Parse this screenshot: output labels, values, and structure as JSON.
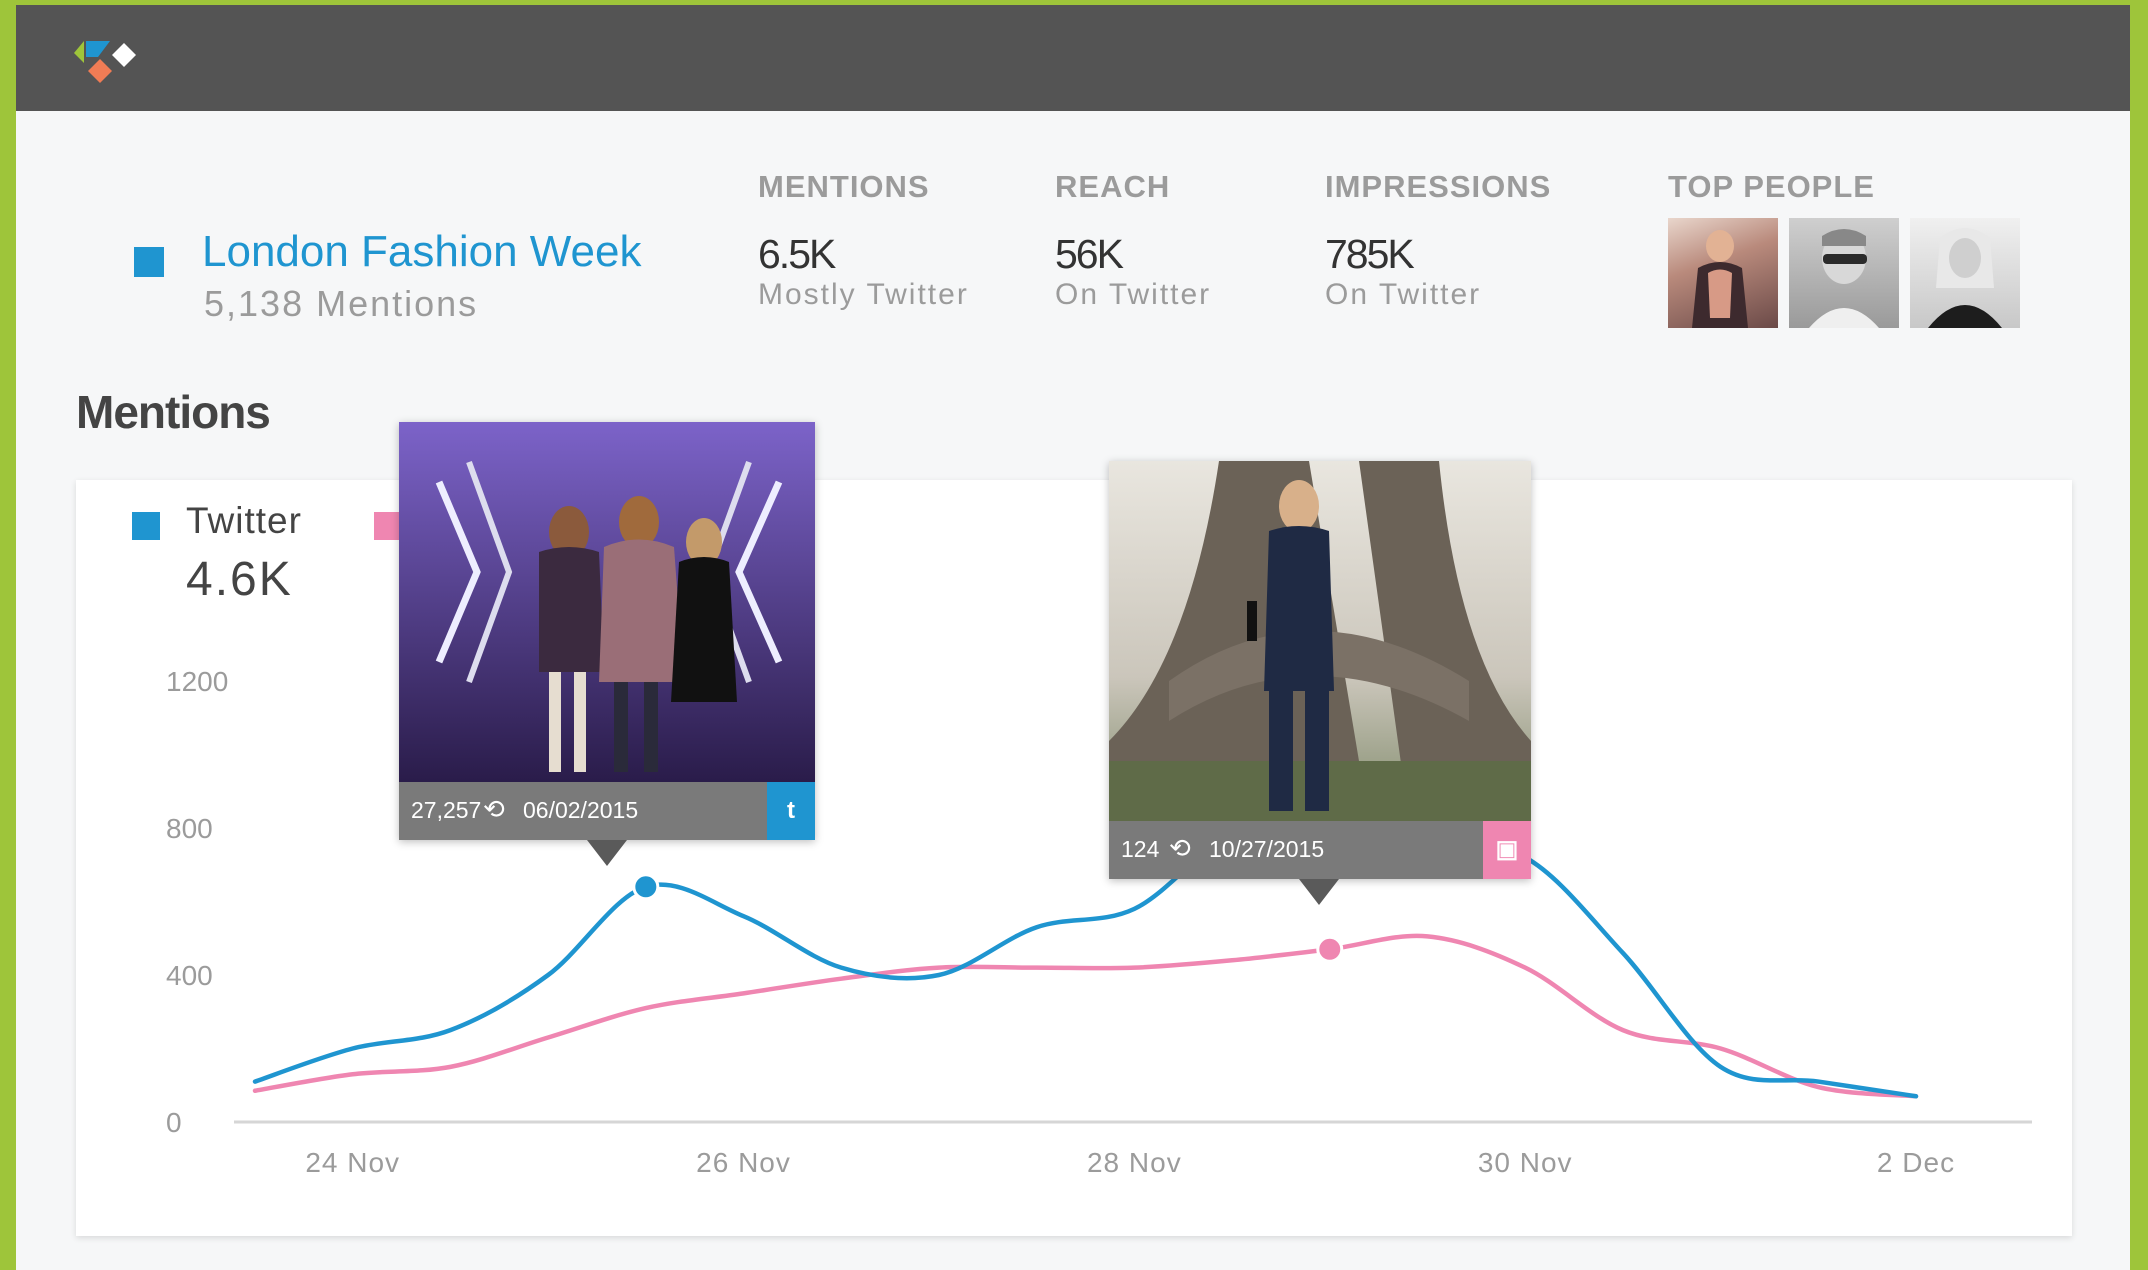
{
  "header": {
    "logo_icon": "kaleidoscope-logo-icon"
  },
  "event": {
    "title": "London Fashion Week",
    "mentions_text": "5,138 Mentions",
    "color": "#1f95d0"
  },
  "metrics": [
    {
      "label": "MENTIONS",
      "value": "6.5K",
      "sub": "Mostly Twitter"
    },
    {
      "label": "REACH",
      "value": "56K",
      "sub": "On Twitter"
    },
    {
      "label": "IMPRESSIONS",
      "value": "785K",
      "sub": "On Twitter"
    }
  ],
  "top_people": {
    "label": "TOP PEOPLE",
    "avatars": [
      "person-avatar",
      "person-avatar",
      "person-avatar"
    ]
  },
  "section": {
    "title": "Mentions"
  },
  "legend": [
    {
      "name": "Twitter",
      "value": "4.6K",
      "color": "#1f95d0"
    },
    {
      "name": "",
      "value": "",
      "color": "#ef86b1"
    }
  ],
  "posts": [
    {
      "count": "27,257",
      "date": "06/02/2015",
      "network": "twitter",
      "net_icon": "twitter-icon",
      "net_color": "#1f95d0"
    },
    {
      "count": "124",
      "date": "10/27/2015",
      "network": "instagram",
      "net_icon": "instagram-icon",
      "net_color": "#ef86b1"
    }
  ],
  "chart_data": {
    "type": "line",
    "x": [
      "23.5 Nov",
      "24 Nov",
      "24.5 Nov",
      "25 Nov",
      "25.5 Nov",
      "26 Nov",
      "26.5 Nov",
      "27 Nov",
      "27.5 Nov",
      "28 Nov",
      "28.5 Nov",
      "29 Nov",
      "29.5 Nov",
      "30 Nov",
      "30.5 Nov",
      "1 Dec",
      "1.5 Dec",
      "2 Dec"
    ],
    "x_ticks": [
      "24 Nov",
      "26 Nov",
      "28 Nov",
      "30 Nov",
      "2 Dec"
    ],
    "y_ticks": [
      "0",
      "400",
      "800",
      "1200"
    ],
    "ylim": [
      0,
      1300
    ],
    "series": [
      {
        "name": "Twitter",
        "color": "#1f95d0",
        "values": [
          110,
          200,
          250,
          400,
          640,
          560,
          420,
          400,
          530,
          580,
          780,
          800,
          750,
          720,
          460,
          150,
          110,
          70
        ]
      },
      {
        "name": "",
        "color": "#ef86b1",
        "values": [
          85,
          130,
          150,
          230,
          310,
          350,
          390,
          420,
          420,
          420,
          440,
          470,
          505,
          420,
          250,
          200,
          95,
          70
        ]
      }
    ],
    "highlight": [
      {
        "series": 0,
        "index": 4
      },
      {
        "series": 1,
        "index": 11
      }
    ]
  }
}
